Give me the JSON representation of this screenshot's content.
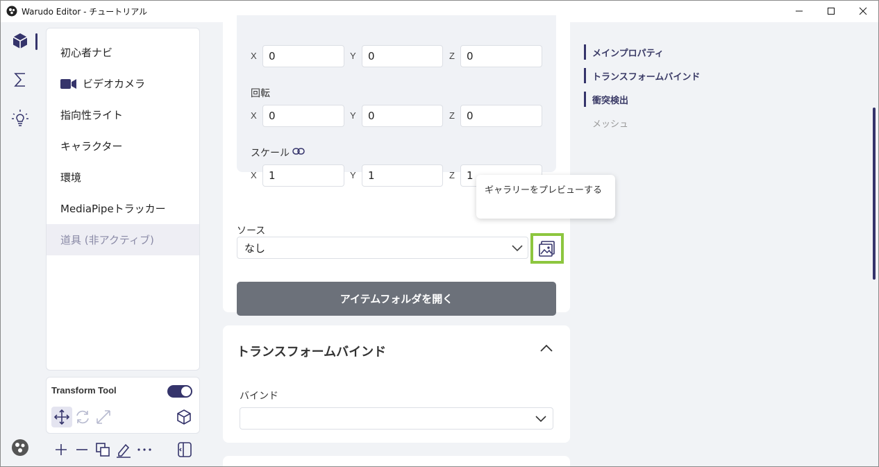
{
  "window": {
    "title": "Warudo Editor - チュートリアル"
  },
  "activitybar": {
    "items": [
      {
        "name": "assets",
        "icon": "cube-icon"
      },
      {
        "name": "blueprints",
        "icon": "sigma-icon"
      },
      {
        "name": "tips",
        "icon": "lightbulb-icon"
      }
    ]
  },
  "sidebar": {
    "items": [
      {
        "label": "初心者ナビ"
      },
      {
        "label": "ビデオカメラ",
        "icon": "video-camera-icon"
      },
      {
        "label": "指向性ライト"
      },
      {
        "label": "キャラクター"
      },
      {
        "label": "環境"
      },
      {
        "label": "MediaPipeトラッカー"
      },
      {
        "label": "道具 (非アクティブ)",
        "state": "inactive"
      }
    ]
  },
  "tool_panel": {
    "title": "Transform Tool",
    "toggle_on": true
  },
  "transform": {
    "axis_x": "X",
    "axis_y": "Y",
    "axis_z": "Z",
    "position": {
      "x": "0",
      "y": "0",
      "z": "0"
    },
    "rotation_label": "回転",
    "rotation": {
      "x": "0",
      "y": "0",
      "z": "0"
    },
    "scale_label": "スケール",
    "scale": {
      "x": "1",
      "y": "1",
      "z": "1"
    }
  },
  "source": {
    "label": "ソース",
    "value": "なし",
    "gallery_tooltip": "ギャラリーをプレビューする"
  },
  "open_folder_button": "アイテムフォルダを開く",
  "transform_bind": {
    "title": "トランスフォームバインド",
    "bind_label": "バインド",
    "bind_value": ""
  },
  "outline": {
    "items": [
      {
        "label": "メインプロパティ"
      },
      {
        "label": "トランスフォームバインド"
      },
      {
        "label": "衝突検出"
      },
      {
        "label": "メッシュ"
      }
    ]
  },
  "colors": {
    "accent": "#35346b",
    "highlight": "#8dc63f",
    "button_gray": "#6c717a"
  }
}
